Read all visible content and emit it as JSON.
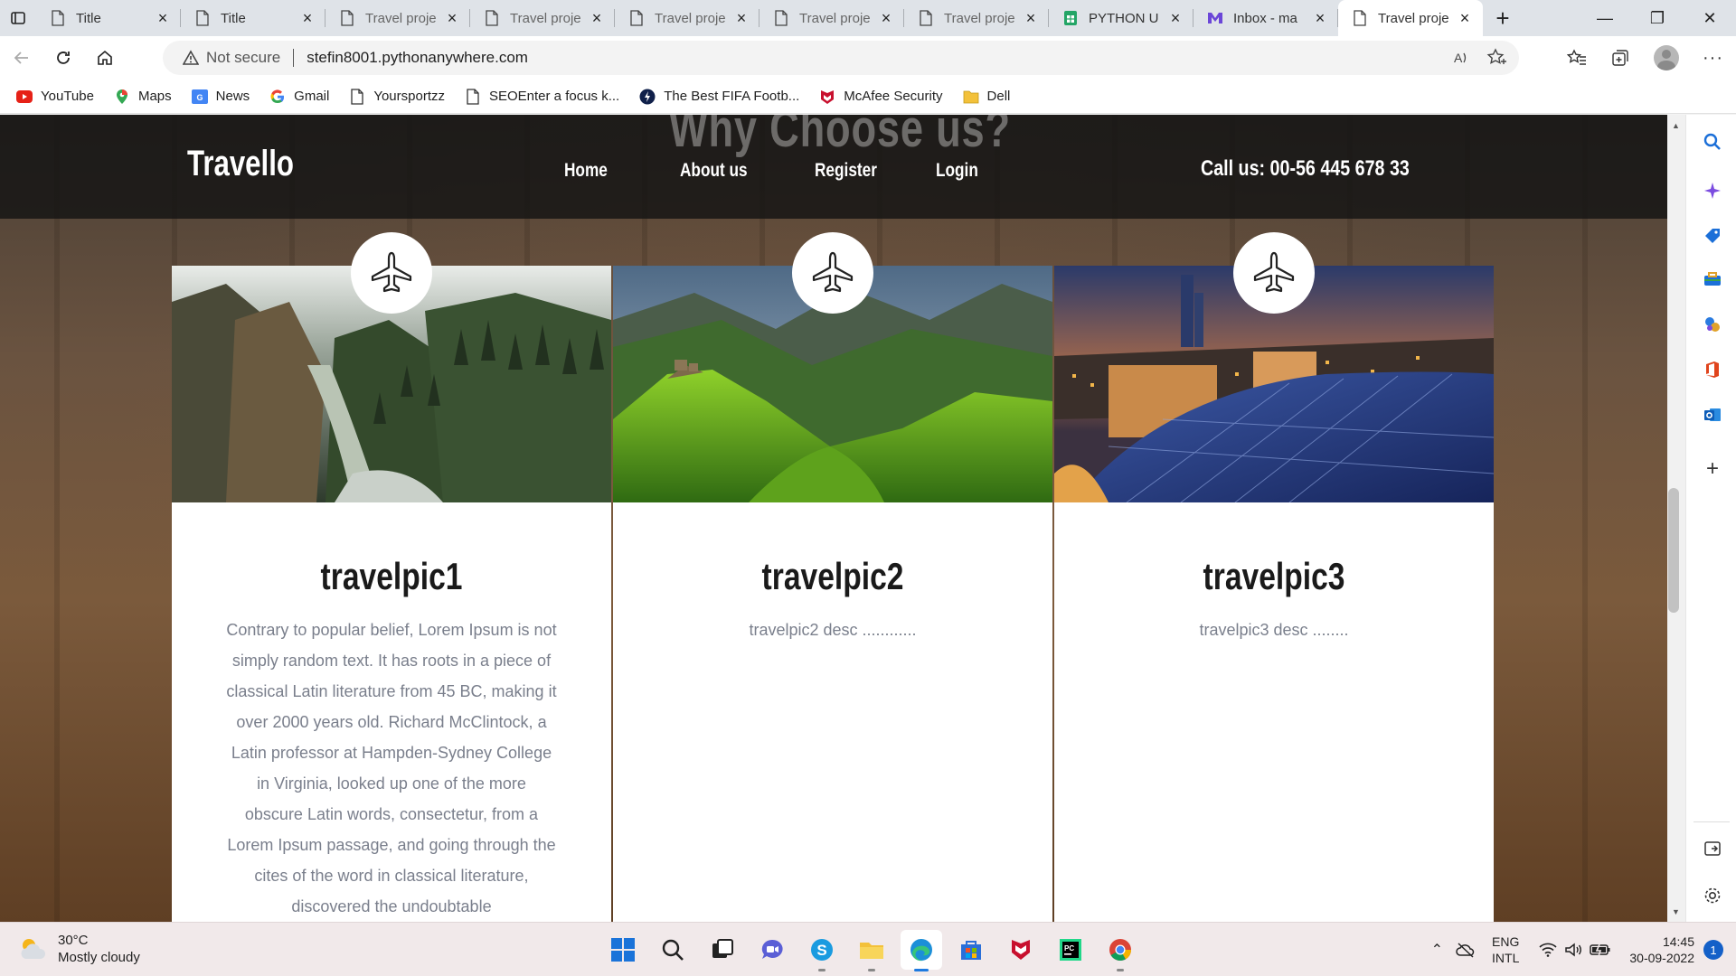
{
  "browser": {
    "tabs": [
      {
        "title": "Title",
        "kind": "page"
      },
      {
        "title": "Title",
        "kind": "page"
      },
      {
        "title": "Travel proje",
        "kind": "page"
      },
      {
        "title": "Travel proje",
        "kind": "page"
      },
      {
        "title": "Travel proje",
        "kind": "page"
      },
      {
        "title": "Travel proje",
        "kind": "page"
      },
      {
        "title": "Travel proje",
        "kind": "page"
      },
      {
        "title": "PYTHON U",
        "kind": "sheets"
      },
      {
        "title": "Inbox - ma",
        "kind": "mail"
      },
      {
        "title": "Travel proje",
        "kind": "page",
        "active": true
      }
    ],
    "address": {
      "security_label": "Not secure",
      "url": "stefin8001.pythonanywhere.com"
    },
    "bookmarks": [
      {
        "label": "YouTube",
        "icon": "youtube-icon"
      },
      {
        "label": "Maps",
        "icon": "maps-icon"
      },
      {
        "label": "News",
        "icon": "news-icon"
      },
      {
        "label": "Gmail",
        "icon": "google-icon"
      },
      {
        "label": "Yoursportzz",
        "icon": "page-icon"
      },
      {
        "label": "SEOEnter a focus k...",
        "icon": "page-icon"
      },
      {
        "label": "The Best FIFA Footb...",
        "icon": "fifa-icon"
      },
      {
        "label": "McAfee Security",
        "icon": "mcafee-icon"
      },
      {
        "label": "Dell",
        "icon": "folder-icon"
      }
    ]
  },
  "site": {
    "ghost_heading": "Why Choose us?",
    "logo": "Travello",
    "nav": [
      "Home",
      "About us",
      "Register",
      "Login"
    ],
    "call_us": "Call us: 00-56 445 678 33",
    "cards": [
      {
        "title": "travelpic1",
        "desc": "Contrary to popular belief, Lorem Ipsum is not simply random text. It has roots in a piece of classical Latin literature from 45 BC, making it over 2000 years old. Richard McClintock, a Latin professor at Hampden-Sydney College in Virginia, looked up one of the more obscure Latin words, consectetur, from a Lorem Ipsum passage, and going through the cites of the word in classical literature, discovered the undoubtable",
        "icon": "airplane-icon"
      },
      {
        "title": "travelpic2",
        "desc": "travelpic2 desc ............",
        "icon": "airplane-icon"
      },
      {
        "title": "travelpic3",
        "desc": "travelpic3 desc ........",
        "icon": "airplane-icon"
      }
    ]
  },
  "taskbar": {
    "weather": {
      "temp": "30°C",
      "condition": "Mostly cloudy"
    },
    "apps": [
      "start-icon",
      "search-icon",
      "task-view-icon",
      "chat-icon",
      "skype-icon",
      "file-explorer-icon",
      "edge-icon",
      "store-icon",
      "mcafee-icon",
      "pycharm-icon",
      "chrome-icon"
    ],
    "lang_line1": "ENG",
    "lang_line2": "INTL",
    "time": "14:45",
    "date": "30-09-2022",
    "notifications": "1"
  },
  "colors": {
    "tabstrip": "#dfe3e8",
    "header_overlay": "#141414",
    "card_desc": "#7a7f8c",
    "accent": "#1e7ae0"
  }
}
